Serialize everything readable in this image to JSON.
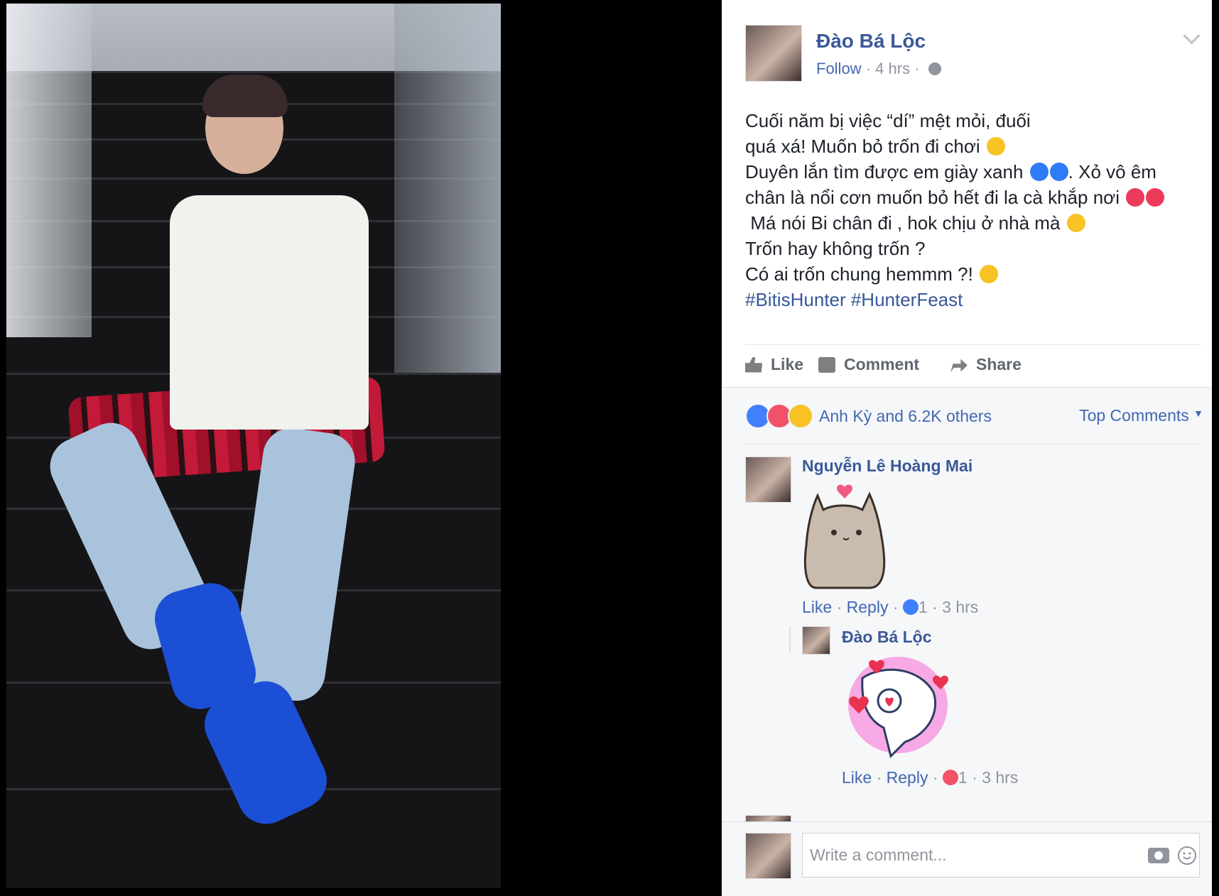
{
  "post": {
    "author": "Đào Bá Lộc",
    "follow_label": "Follow",
    "time": "4 hrs",
    "text_lines": [
      "Cuối năm bị việc “dí” mệt mỏi, đuối",
      "quá xá! Muốn bỏ trốn đi chơi",
      "Duyên lắn tìm được em giày xanh",
      ". Xỏ vô êm",
      "chân là nổi cơn muốn bỏ hết đi la cà khắp nơi",
      "Má nói Bi chân đi , hok chịu ở nhà mà",
      "Trốn hay không trốn ?",
      "Có ai trốn chung hemmm ?!"
    ],
    "hashtags": "#BitisHunter #HunterFeast"
  },
  "actions": {
    "like": "Like",
    "comment": "Comment",
    "share": "Share"
  },
  "reactions": {
    "summary": "Anh Kỳ and 6.2K others",
    "sort_label": "Top Comments"
  },
  "comments": [
    {
      "name": "Nguyễn Lê Hoàng Mai",
      "like": "Like",
      "reply": "Reply",
      "reaction_count": "1",
      "time": "3 hrs"
    }
  ],
  "replies": [
    {
      "name": "Đào Bá Lộc",
      "like": "Like",
      "reply": "Reply",
      "reaction_count": "1",
      "time": "3 hrs"
    }
  ],
  "composer": {
    "placeholder": "Write a comment..."
  },
  "colors": {
    "link_blue": "#4267b2",
    "name_blue": "#3b5998",
    "meta_grey": "#90949c",
    "love_red": "#f25268"
  },
  "icons": [
    "globe-icon",
    "chevron-down-icon",
    "like-icon",
    "comment-icon",
    "share-icon",
    "camera-icon",
    "smile-icon"
  ]
}
